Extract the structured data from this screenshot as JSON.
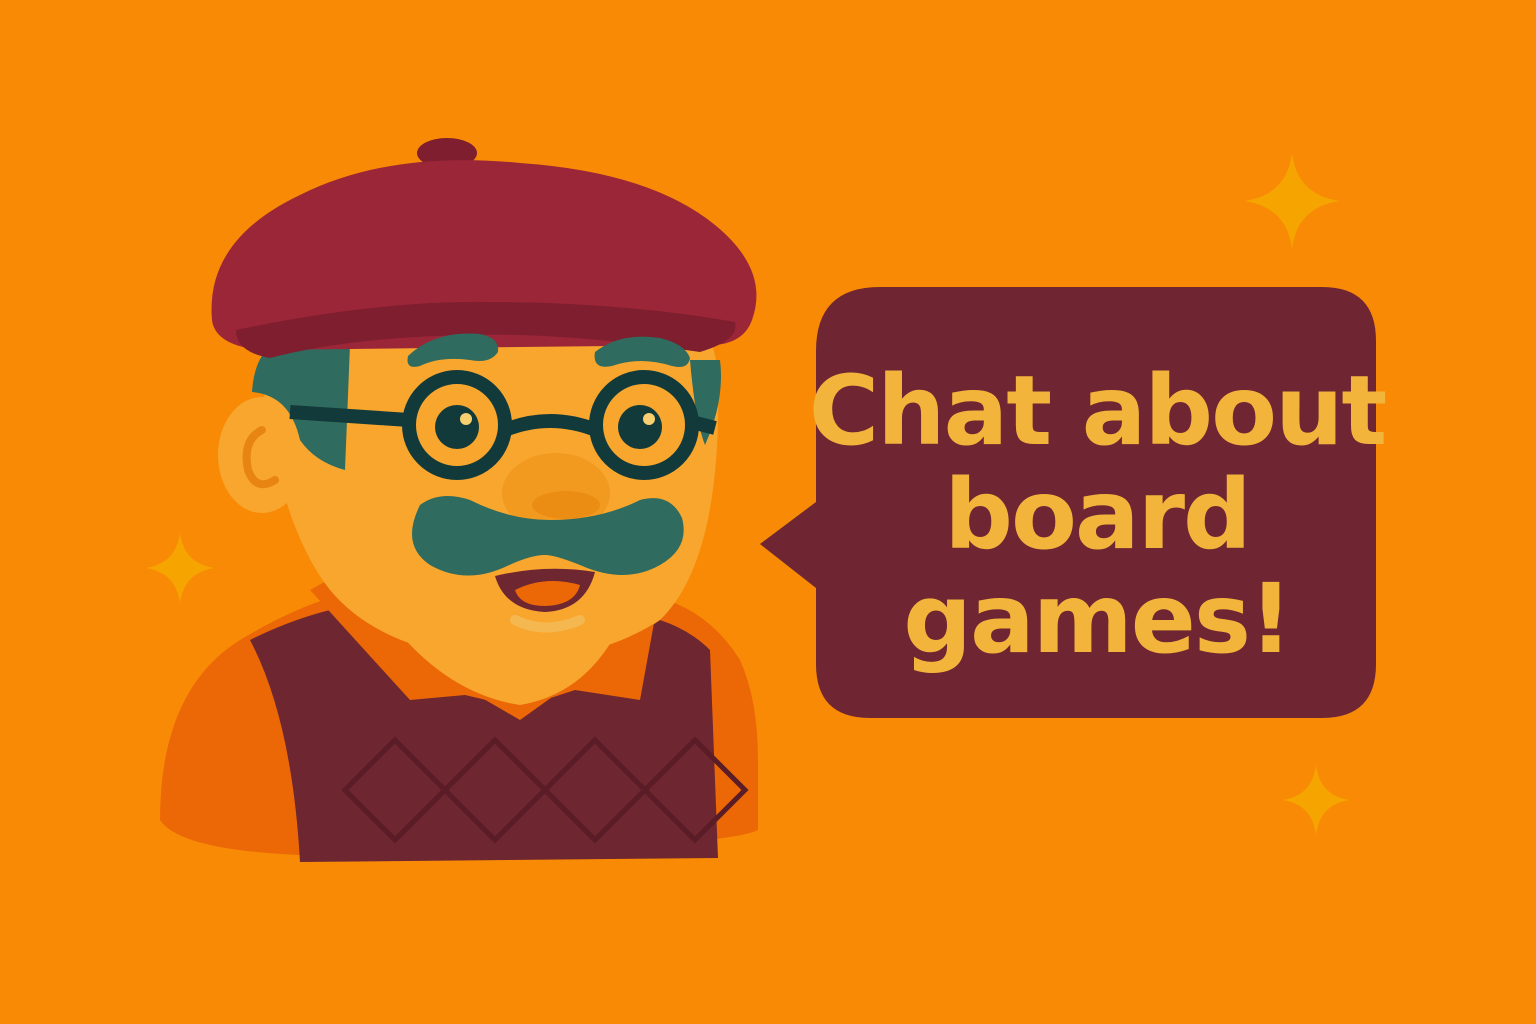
{
  "background_color": "#F98A06",
  "speech_bubble": {
    "lines": [
      "Chat about",
      "board",
      "games!"
    ],
    "fill_color": "#6F2532",
    "text_color": "#F2B43A"
  },
  "character": {
    "beret_color": "#9B2638",
    "skin_color": "#F8A62E",
    "hair_color": "#2F6B5E",
    "vest_color": "#6E2631",
    "collar_color": "#EC6806"
  },
  "sparkle_color": "#F6A500"
}
